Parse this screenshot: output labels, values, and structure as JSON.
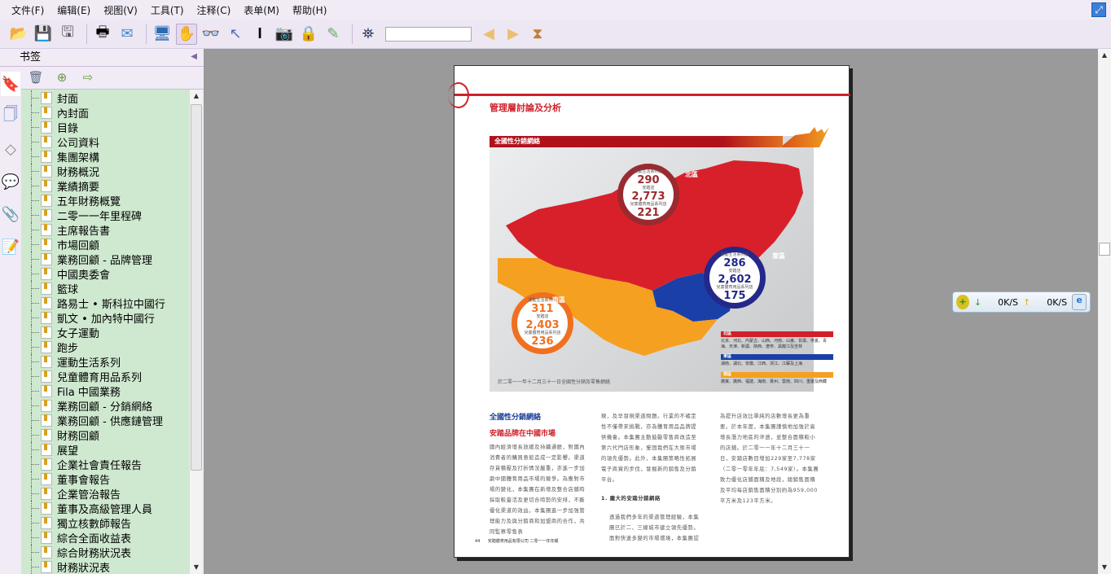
{
  "menu": [
    "文件(F)",
    "编辑(E)",
    "视图(V)",
    "工具(T)",
    "注释(C)",
    "表单(M)",
    "帮助(H)"
  ],
  "toolbar": {
    "search_value": "",
    "search_placeholder": ""
  },
  "panel": {
    "title": "书签"
  },
  "bookmarks": [
    "封面",
    "內封面",
    "目錄",
    "公司資料",
    "集團架構",
    "財務概況",
    "業績摘要",
    "五年財務概覽",
    "二零一一年里程碑",
    "主席報告書",
    "市場回顧",
    "業務回顧 - 品牌管理",
    "中國奧委會",
    "籃球",
    "路易士 • 斯科拉中國行",
    "凱文 • 加內特中國行",
    "女子運動",
    "跑步",
    "運動生活系列",
    "兒童體育用品系列",
    "Fila 中國業務",
    "業務回顧 - 分銷網絡",
    "業務回顧 - 供應鏈管理",
    "財務回顧",
    "展望",
    "企業社會責任報告",
    "董事會報告",
    "企業管治報告",
    "董事及高級管理人員",
    "獨立核數師報告",
    "綜合全面收益表",
    "綜合財務狀況表",
    "財務狀況表"
  ],
  "page": {
    "section": "管理層討論及分析",
    "map_title": "全國性分銷網絡",
    "map_caption": "於二零一一年十二月三十一日全國性分銷及零售網絡",
    "labels": {
      "sport": "運動生活系列店",
      "anta": "安踏店",
      "kids": "兒童體育用品系列店"
    },
    "regions": [
      {
        "name": "北區",
        "sport": "290",
        "anta": "2,773",
        "kids": "221",
        "color": "#9a2a30",
        "provinces": "北京、河北、內蒙古、山西、河南、山東、甘肅、寧夏、青海、天津、新疆、陝西、遼寧、黑龍江及吉林"
      },
      {
        "name": "東區",
        "sport": "286",
        "anta": "2,602",
        "kids": "175",
        "color": "#23288a",
        "provinces": "湖南、湖北、安徽、江西、浙江、江蘇及上海"
      },
      {
        "name": "南區",
        "sport": "311",
        "anta": "2,403",
        "kids": "236",
        "color": "#f07020",
        "provinces": "廣東、廣西、福建、海南、貴州、雲南、四川、重慶及西藏"
      }
    ],
    "heading_blue": "全國性分銷網絡",
    "heading_red": "安踏品牌在中國市場",
    "col1": "國內經濟增長放緩及持續通脹，對國內消費者的購買意慾造成一定影響。渠道存貨積壓及打折情況嚴重，亦進一步加劇中國體育用品市場的競爭。為應對市場的變化，本集團在新增及整合店鋪時採取較靈活及更切合時勢的安排，不斷優化渠道的效益。本集團進一步加強管理能力及與分銷商和加盟商的合作，共同監察零售表",
    "col2a": "現，及早發現渠道問題。行業的不確定性不僅帶來挑戰，亦為體育用品品牌提供機會。本集團主動鼓勵零售商改造至第六代門店形象，鞏固我們在大眾市場的領先優勢。此外，本集團策略性拓展電子商貿的步伐，發掘新的銷售及分銷平台。",
    "col2_heading": "1.  龐大的安踏分銷網絡",
    "col2b": "透過我們多年的渠道管理經驗，本集團已於二、三線城市建立領先優勢。面對快速多變的市場環境，本集團認",
    "col3": "為提升店效比單純的店數增長更為重要。於本年度，本集團謹慎地加強於高增長潛力地區的滲透，並整合面積較小的店鋪。於二零一一年十二月三十一日，安踏店數目增加229家至7,778家（二零一零年年底：7,549家）。本集團致力優化店鋪面積及地段，總銷售面積及平均每店銷售面積分別約為959,000平方米及123平方米。",
    "page_number": "44",
    "footer": "安踏體育用品有限公司  二零一一年年報"
  },
  "netmonitor": {
    "down": "0K/S",
    "up": "0K/S"
  }
}
